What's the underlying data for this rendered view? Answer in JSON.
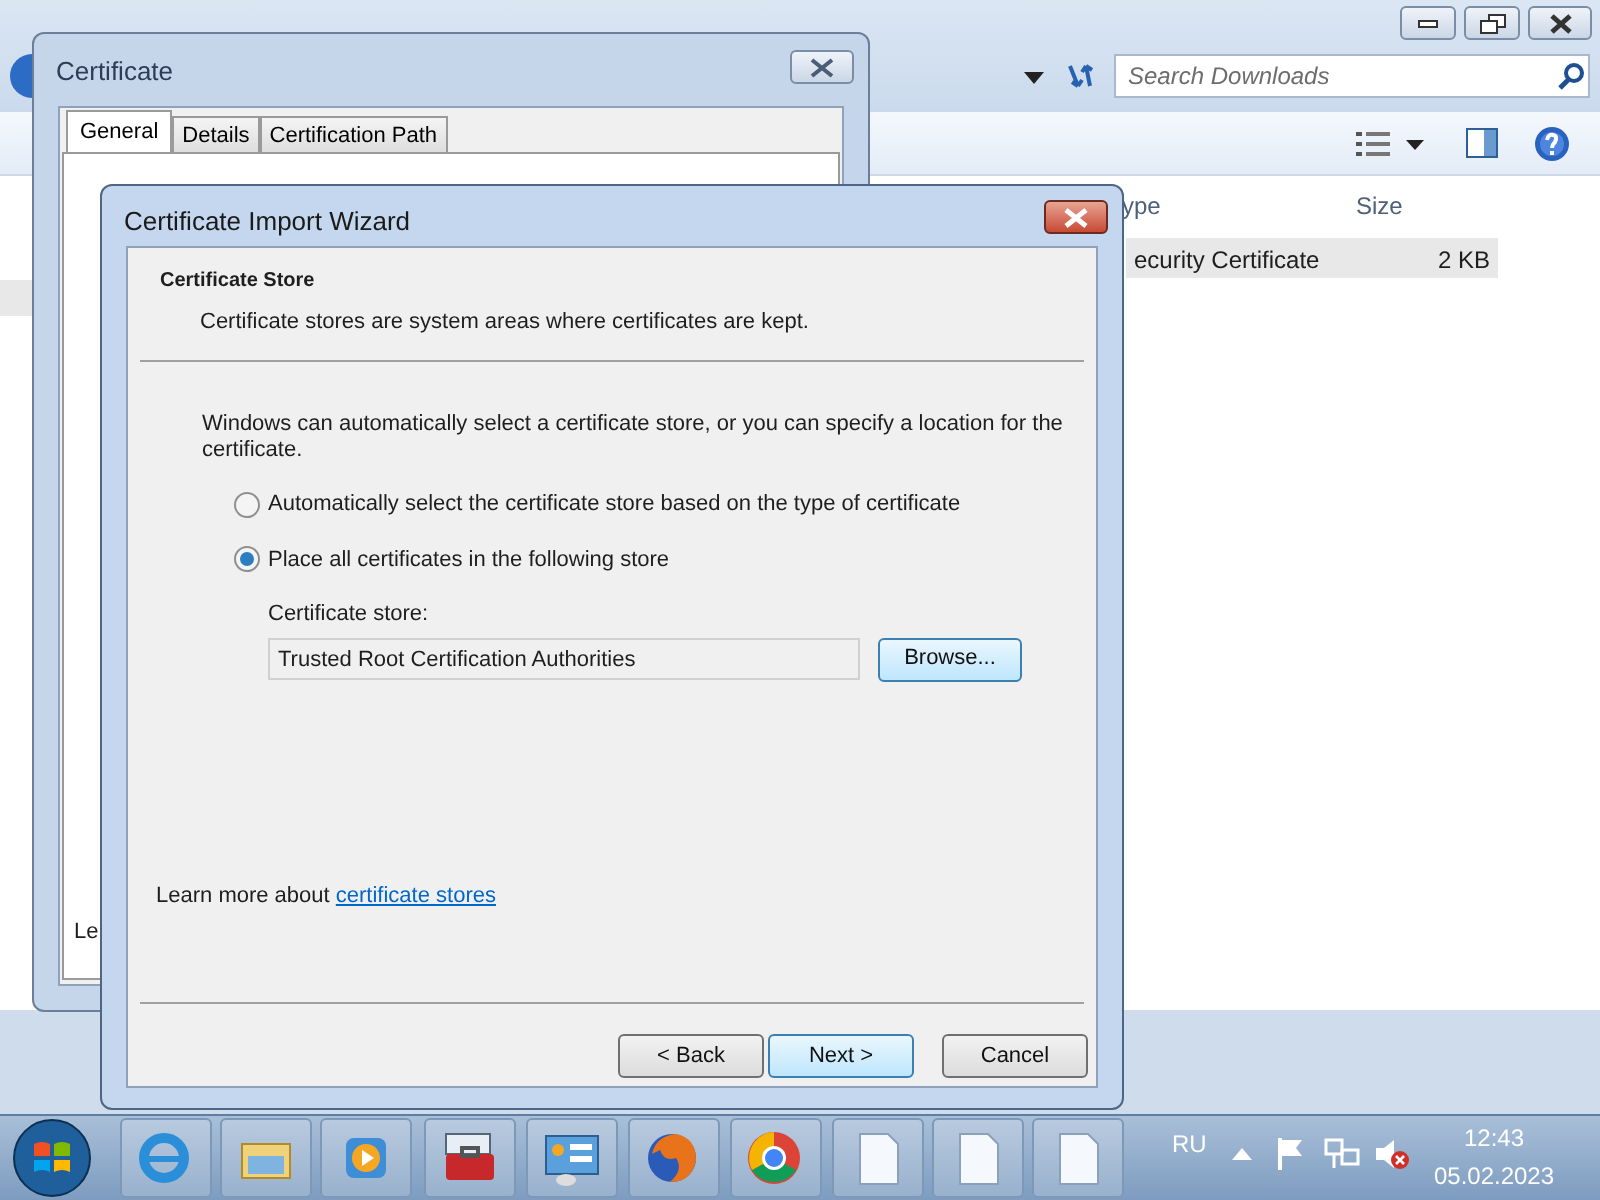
{
  "explorer": {
    "search": {
      "placeholder": "Search Downloads"
    },
    "columns": [
      "ype",
      "Size"
    ],
    "rows": [
      {
        "name": "ecurity Certificate",
        "size": "2 KB",
        "selected": true
      }
    ]
  },
  "certificate_dialog": {
    "title": "Certificate",
    "tabs": [
      {
        "label": "General",
        "selected": true
      },
      {
        "label": "Details",
        "selected": false
      },
      {
        "label": "Certification Path",
        "selected": false
      }
    ],
    "body_text": "Le"
  },
  "wizard": {
    "title": "Certificate Import Wizard",
    "header_title": "Certificate Store",
    "header_subtitle": "Certificate stores are system areas where certificates are kept.",
    "intro": "Windows can automatically select a certificate store, or you can specify a location for the certificate.",
    "options": [
      {
        "label": "Automatically select the certificate store based on the type of certificate",
        "selected": false
      },
      {
        "label": "Place all certificates in the following store",
        "selected": true
      }
    ],
    "store_label": "Certificate store:",
    "store_value": "Trusted Root Certification Authorities",
    "browse": "Browse...",
    "learn_more": {
      "text": "Learn more about ",
      "link": "certificate stores"
    },
    "buttons": [
      {
        "label": "< Back",
        "default": false
      },
      {
        "label": "Next >",
        "default": true
      },
      {
        "label": "Cancel",
        "default": false
      }
    ]
  },
  "taskbar": {
    "language": "RU",
    "time": "12:43",
    "date": "05.02.2023"
  }
}
